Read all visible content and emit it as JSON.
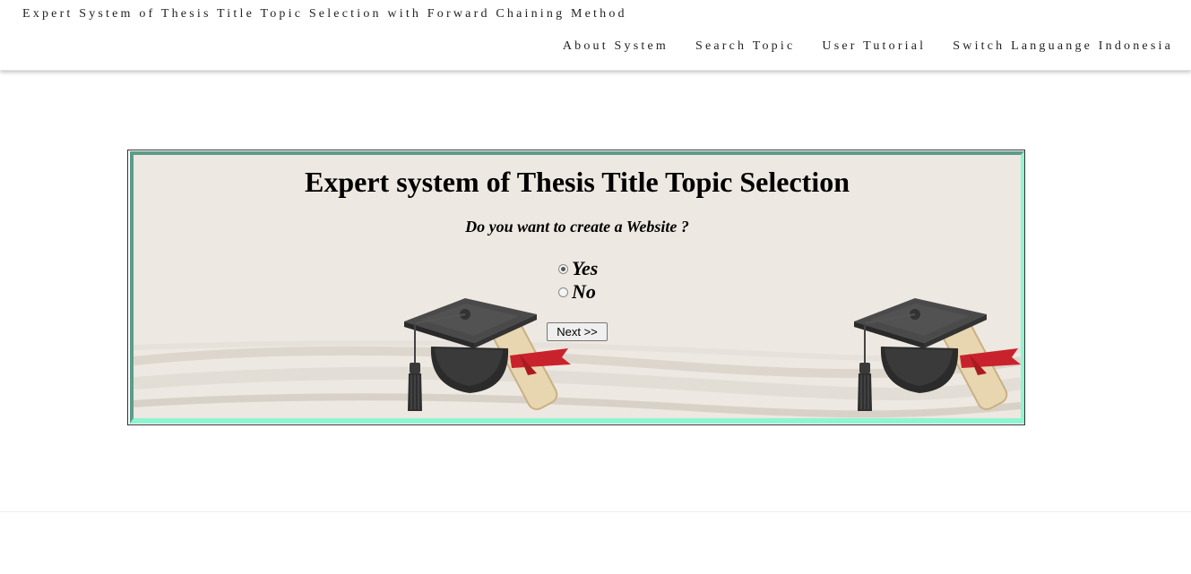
{
  "header": {
    "site_title": "Expert System of Thesis Title Topic Selection with Forward Chaining Method",
    "nav": [
      {
        "label": "About System"
      },
      {
        "label": "Search Topic"
      },
      {
        "label": "User Tutorial"
      },
      {
        "label": "Switch Languange Indonesia"
      }
    ]
  },
  "panel": {
    "title": "Expert system of Thesis Title Topic Selection",
    "question": "Do you want to create a Website ?",
    "options": [
      {
        "label": "Yes",
        "selected": true
      },
      {
        "label": "No",
        "selected": false
      }
    ],
    "next_label": "Next >>",
    "decoration_icon": "graduation-cap-diploma-icon"
  },
  "colors": {
    "panel_bg": "#ede8e1",
    "border_dark": "#5c9c88",
    "border_light": "#8ff5d0"
  }
}
